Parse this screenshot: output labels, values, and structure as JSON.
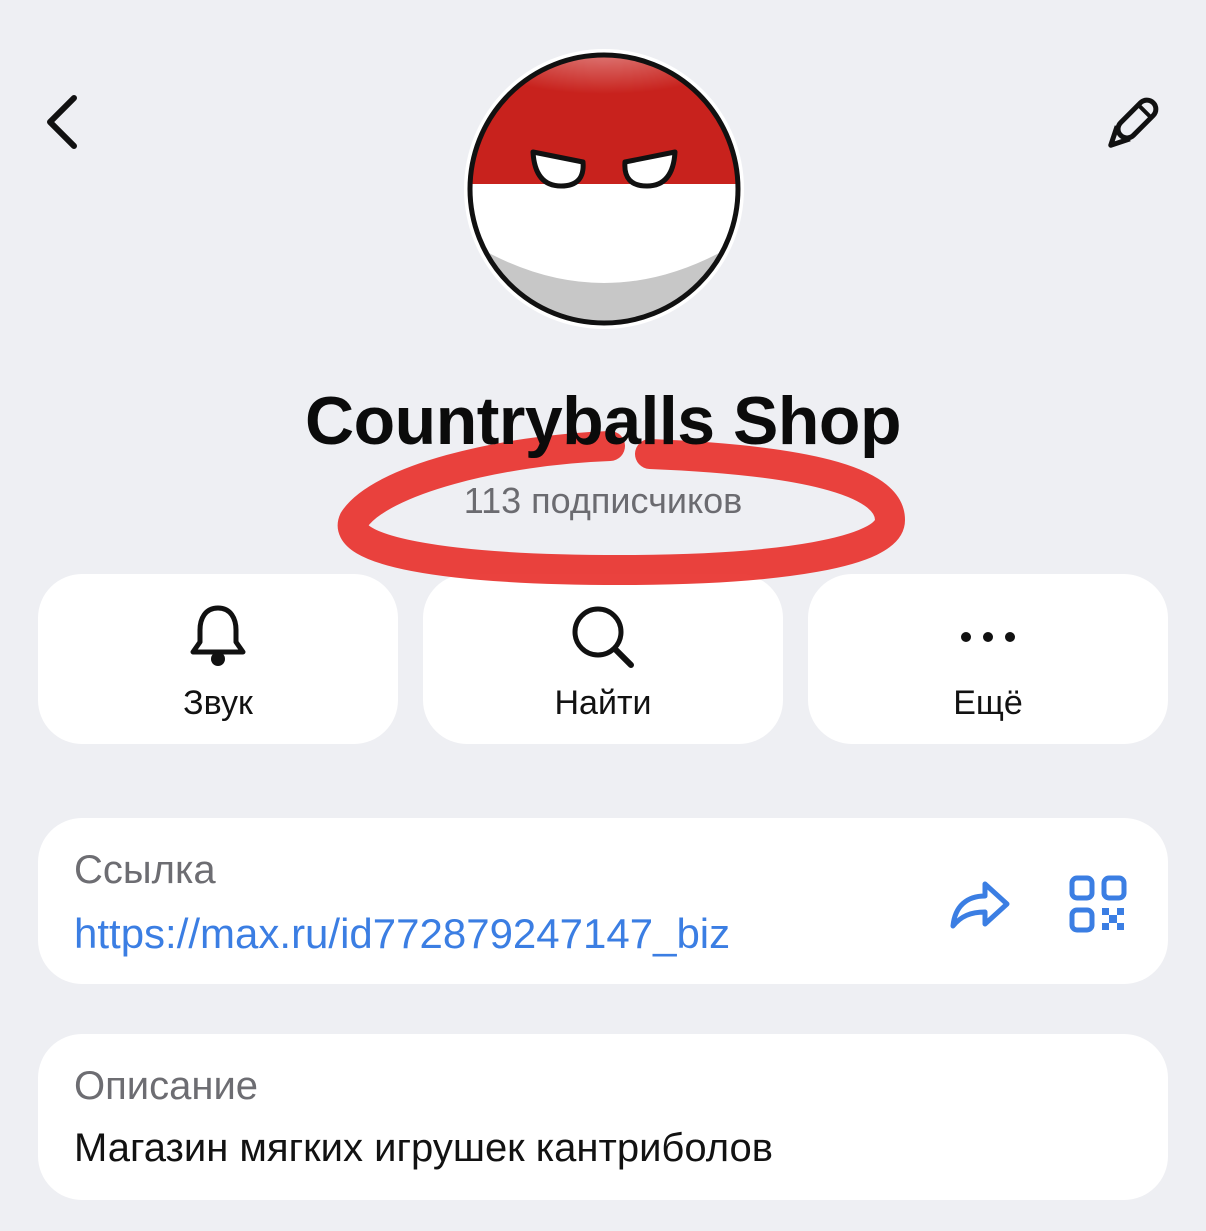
{
  "header": {
    "back_icon": "chevron-left-icon",
    "edit_icon": "pencil-icon"
  },
  "profile": {
    "avatar": "countryball-avatar",
    "name": "Countryballs Shop",
    "subscribers": "113 подписчиков"
  },
  "actions": [
    {
      "label": "Звук",
      "icon": "bell-icon"
    },
    {
      "label": "Найти",
      "icon": "search-icon"
    },
    {
      "label": "Ещё",
      "icon": "more-icon"
    }
  ],
  "link_card": {
    "label": "Ссылка",
    "value": "https://max.ru/id772879247147_biz",
    "share_icon": "share-icon",
    "qr_icon": "qr-code-icon"
  },
  "description_card": {
    "label": "Описание",
    "value": "Магазин мягких игрушек кантриболов"
  },
  "colors": {
    "background": "#eeeff3",
    "card": "#ffffff",
    "link": "#3b7ee3",
    "annotation": "#e8322e",
    "avatar_red": "#c8221d"
  }
}
